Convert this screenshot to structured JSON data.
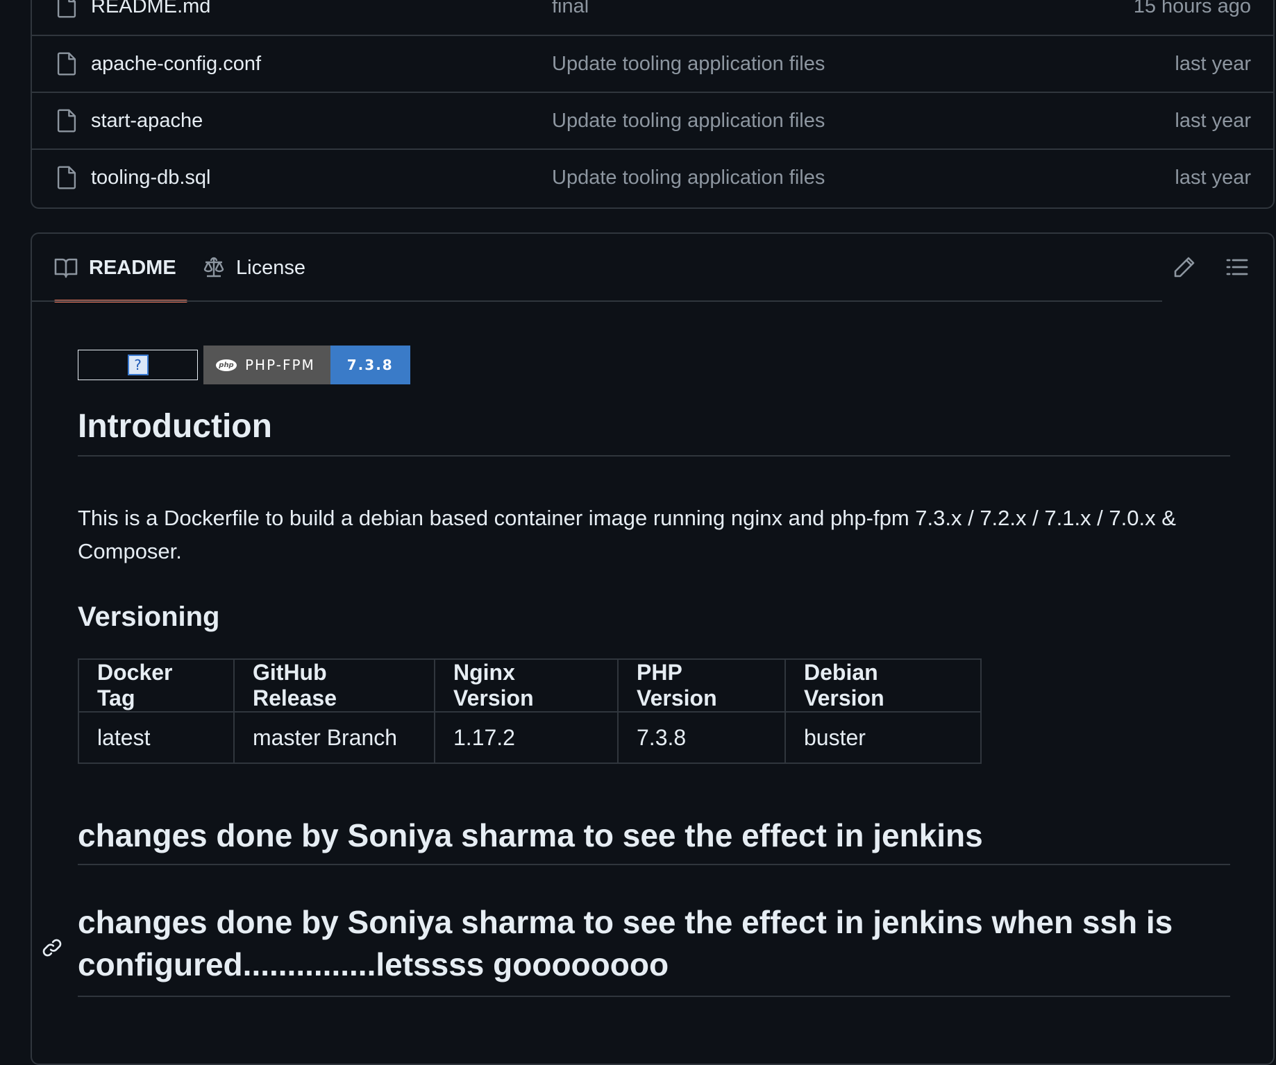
{
  "files": [
    {
      "name": "README.md",
      "message": "final",
      "age": "15 hours ago"
    },
    {
      "name": "apache-config.conf",
      "message": "Update tooling application files",
      "age": "last year"
    },
    {
      "name": "start-apache",
      "message": "Update tooling application files",
      "age": "last year"
    },
    {
      "name": "tooling-db.sql",
      "message": "Update tooling application files",
      "age": "last year"
    }
  ],
  "readme": {
    "tabs": {
      "readme": "README",
      "license": "License"
    },
    "badges": {
      "broken_glyph": "?",
      "php_logo": "php",
      "php_label": "PHP-FPM",
      "php_version": "7.3.8"
    },
    "intro_title": "Introduction",
    "intro_text": "This is a Dockerfile to build a debian based container image running nginx and php-fpm 7.3.x / 7.2.x / 7.1.x / 7.0.x & Composer.",
    "versioning_title": "Versioning",
    "table": {
      "headers": [
        "Docker Tag",
        "GitHub Release",
        "Nginx Version",
        "PHP Version",
        "Debian Version"
      ],
      "rows": [
        [
          "latest",
          "master Branch",
          "1.17.2",
          "7.3.8",
          "buster"
        ]
      ]
    },
    "heading_1": "changes done by Soniya sharma to see the effect in jenkins",
    "heading_2": "changes done by Soniya sharma to see the effect in jenkins when ssh is configured...............letssss goooooooo"
  },
  "colors": {
    "background": "#0d1117",
    "border": "#30363d",
    "muted_text": "#8d96a0",
    "active_tab": "#f78166",
    "badge_gray": "#555555",
    "badge_blue": "#3a7bc8"
  },
  "icons": [
    "file-icon",
    "book-icon",
    "law-icon",
    "pencil-icon",
    "list-icon",
    "link-icon"
  ]
}
